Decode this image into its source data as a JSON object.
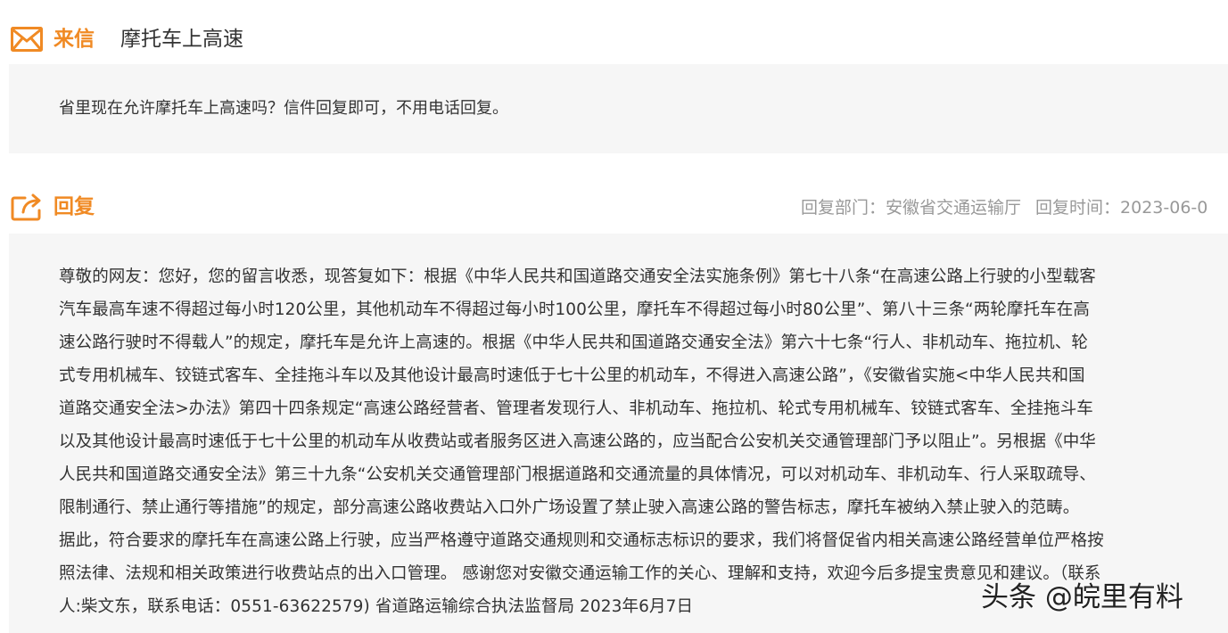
{
  "letter": {
    "label": "来信",
    "subject": "摩托车上高速",
    "content": "省里现在允许摩托车上高速吗？信件回复即可，不用电话回复。",
    "icon": "mail-icon"
  },
  "reply": {
    "label": "回复",
    "icon": "reply-share-icon",
    "department": "回复部门：安徽省交通运输厅",
    "time": "回复时间：2023-06-0",
    "lines": [
      "尊敬的网友：您好，您的留言收悉，现答复如下：根据《中华人民共和国道路交通安全法实施条例》第七十八条“在高速公路上行驶的小型载客",
      "汽车最高车速不得超过每小时120公里，其他机动车不得超过每小时100公里，摩托车不得超过每小时80公里”、第八十三条“两轮摩托车在高",
      "速公路行驶时不得载人”的规定，摩托车是允许上高速的。根据《中华人民共和国道路交通安全法》第六十七条“行人、非机动车、拖拉机、轮",
      "式专用机械车、铰链式客车、全挂拖斗车以及其他设计最高时速低于七十公里的机动车，不得进入高速公路”，《安徽省实施<中华人民共和国",
      "道路交通安全法>办法》第四十四条规定“高速公路经营者、管理者发现行人、非机动车、拖拉机、轮式专用机械车、铰链式客车、全挂拖斗车",
      "以及其他设计最高时速低于七十公里的机动车从收费站或者服务区进入高速公路的，应当配合公安机关交通管理部门予以阻止”。另根据《中华",
      "人民共和国道路交通安全法》第三十九条“公安机关交通管理部门根据道路和交通流量的具体情况，可以对机动车、非机动车、行人采取疏导、",
      "限制通行、禁止通行等措施”的规定，部分高速公路收费站入口外广场设置了禁止驶入高速公路的警告标志，摩托车被纳入禁止驶入的范畴。",
      "据此，符合要求的摩托车在高速公路上行驶，应当严格遵守道路交通规则和交通标志标识的要求，我们将督促省内相关高速公路经营单位严格按",
      "照法律、法规和相关政策进行收费站点的出入口管理。 感谢您对安徽交通运输工作的关心、理解和支持，欢迎今后多提宝贵意见和建议。（联系",
      "人:柴文东，联系电话：0551-63622579) 省道路运输综合执法监督局 2023年6月7日"
    ]
  },
  "watermark": {
    "text": "头条 @皖里有料"
  },
  "colors": {
    "accent": "#f08a24",
    "panel_bg": "#f6f6f6",
    "meta_text": "#999999",
    "body_text": "#333333"
  }
}
